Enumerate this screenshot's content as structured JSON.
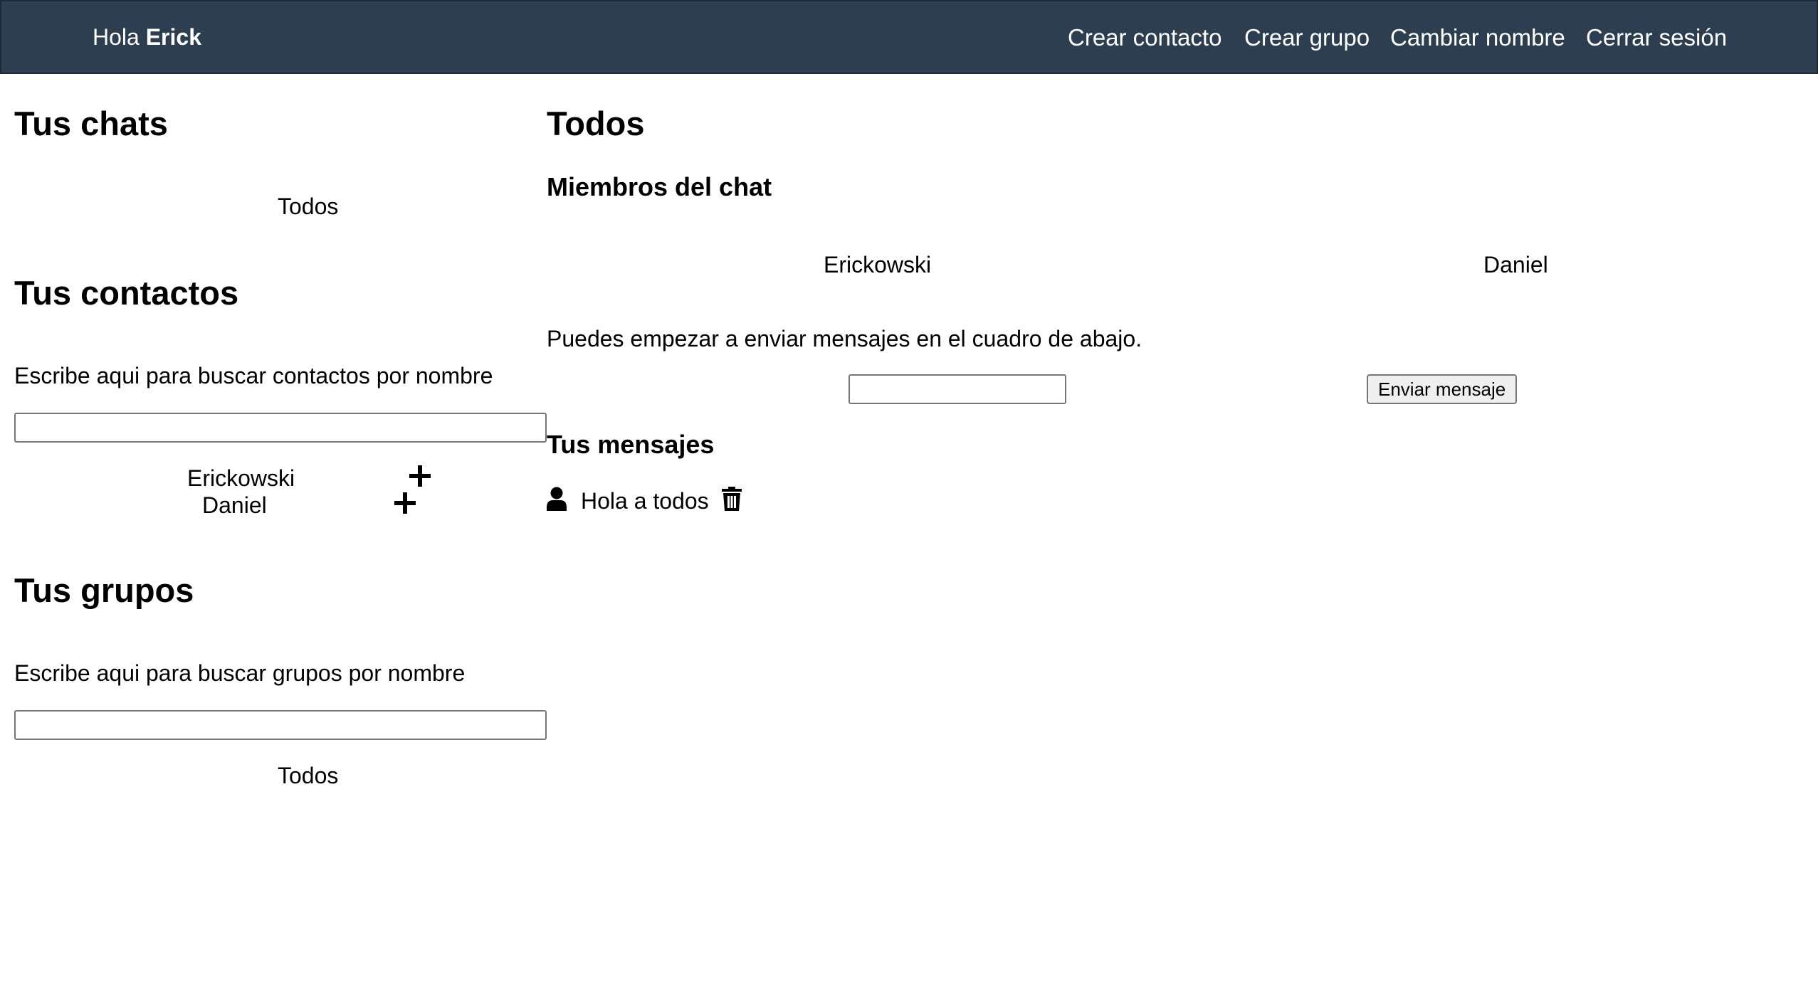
{
  "header": {
    "greeting_prefix": "Hola",
    "user_name": "Erick",
    "nav": {
      "create_contact": "Crear contacto",
      "create_group": "Crear grupo",
      "change_name": "Cambiar nombre",
      "logout": "Cerrar sesión"
    },
    "background_color": "#2e3e51"
  },
  "sidebar": {
    "chats": {
      "title": "Tus chats",
      "items": [
        "Todos"
      ]
    },
    "contacts": {
      "title": "Tus contactos",
      "search_hint": "Escribe aqui para buscar contactos por nombre",
      "search_value": "",
      "items": [
        "Erickowski",
        "Daniel"
      ]
    },
    "groups": {
      "title": "Tus grupos",
      "search_hint": "Escribe aqui para buscar grupos por nombre",
      "search_value": "",
      "items": [
        "Todos"
      ]
    }
  },
  "main": {
    "chat_title": "Todos",
    "members_title": "Miembros del chat",
    "members": [
      "Erickowski",
      "Daniel"
    ],
    "instructions": "Puedes empezar a enviar mensajes en el cuadro de abajo.",
    "message_input_value": "",
    "send_button": "Enviar mensaje",
    "messages_title": "Tus mensajes",
    "messages": [
      {
        "text": "Hola a todos",
        "avatar_icon": "user-icon",
        "delete_icon": "trash-icon"
      }
    ]
  }
}
